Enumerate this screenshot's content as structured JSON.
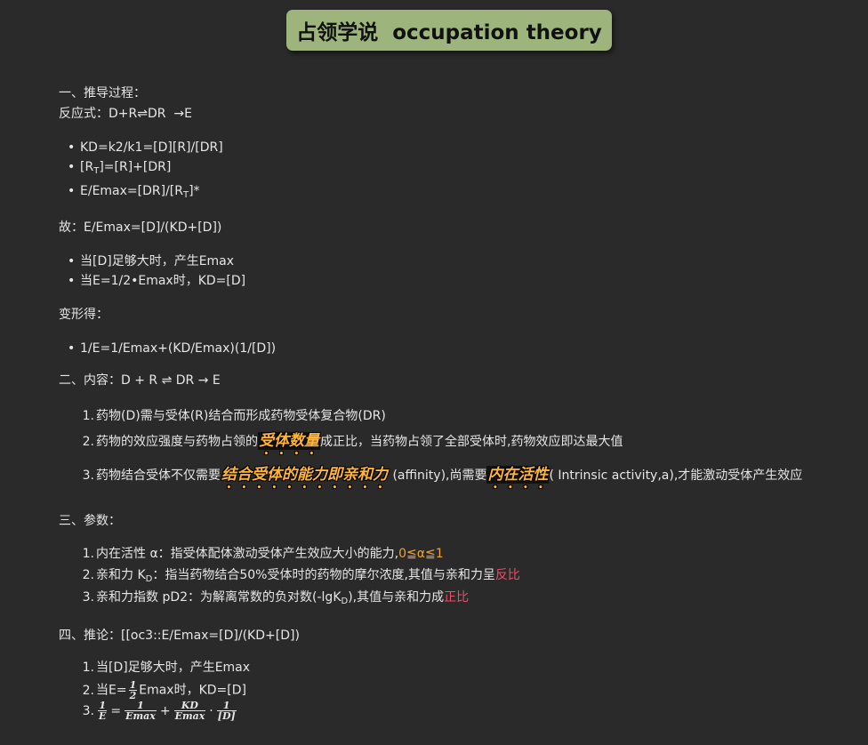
{
  "title": "占领学说  occupation theory",
  "s1": {
    "heading": "一、推导过程：",
    "reaction": "反应式：D+R⇌DR  →E",
    "b1": "KD=k2/k1=[D][R]/[DR]",
    "b2_pre": "[R",
    "b2_sub": "T",
    "b2_post": "]=[R]+[DR]",
    "b3_pre": "E/Emax=[DR]/[R",
    "b3_sub": "T",
    "b3_post": "]*",
    "therefore": "故：E/Emax=[D]/(KD+[D])",
    "b4": "当[D]足够大时，产生Emax",
    "b5": "当E=1/2•Emax时，KD=[D]",
    "transform": "变形得：",
    "b6": "1/E=1/Emax+(KD/Emax)(1/[D])"
  },
  "s2": {
    "heading": "二、内容：D + R ⇌ DR → E",
    "i1": "药物(D)需与受体(R)结合而形成药物受体复合物(DR)",
    "i2_pre": "药物的效应强度与药物占领的",
    "i2_hl": "受体数量",
    "i2_post": "成正比，当药物占领了全部受体时,药物效应即达最大值",
    "i3_pre": "药物结合受体不仅需要",
    "i3_hl1": "结合受体的能力即亲和力",
    "i3_mid": " (affinity),尚需要",
    "i3_hl2": "内在活性",
    "i3_post": "( Intrinsic activity,a),才能激动受体产生效应"
  },
  "s3": {
    "heading": "三、参数：",
    "p1_pre": "内在活性 α：指受体配体激动受体产生效应大小的能力,",
    "p1_range": "0≦α≦1",
    "p2_pre": "亲和力 K",
    "p2_sub": "D",
    "p2_mid": "：指当药物结合50%受体时的药物的摩尔浓度,其值与亲和力呈",
    "p2_red": "反比",
    "p3_pre": "亲和力指数 pD2：为解离常数的负对数(-lgK",
    "p3_sub": "D",
    "p3_mid": "),其值与亲和力成",
    "p3_red": "正比"
  },
  "s4": {
    "heading": "四、推论：[[oc3::E/Emax=[D]/(KD+[D])",
    "c1": "当[D]足够大时，产生Emax",
    "c2_pre": "当E=",
    "c2_n": "1",
    "c2_d": "2",
    "c2_post": "Emax时，KD=[D]",
    "c3": {
      "n1": "1",
      "d1": "E",
      "eq": "=",
      "n2": "1",
      "d2": "Emax",
      "plus": "+",
      "n3": "KD",
      "d3": "Emax",
      "dot": "·",
      "n4": "1",
      "d4": "[D]"
    }
  },
  "nums": [
    "1.",
    "2.",
    "3."
  ]
}
